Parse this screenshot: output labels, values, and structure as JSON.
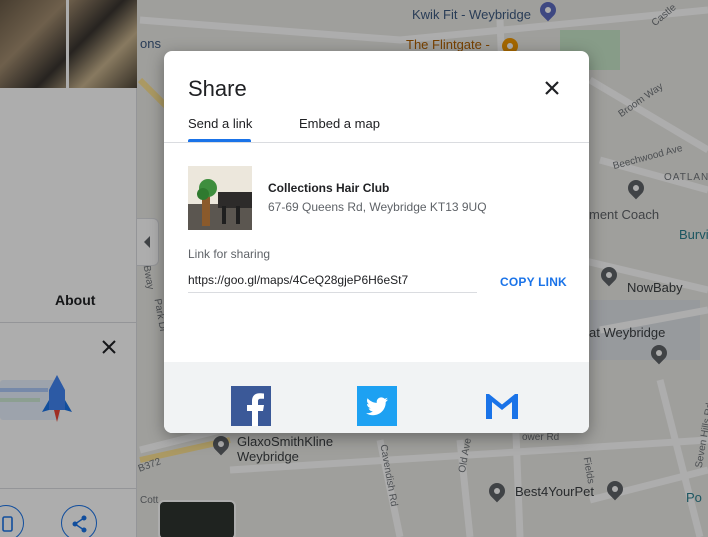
{
  "map": {
    "labels": {
      "kwik_fit": "Kwik Fit - Weybridge",
      "flintgate": "The Flintgate -",
      "ons": "ons",
      "castle": "Castle",
      "broom_way": "Broom Way",
      "beechwood": "Beechwood Ave",
      "oatlands": "OATLANDI",
      "coach": "ment Coach",
      "burvi": "Burvi",
      "nowbaby": "NowBaby",
      "at_weybridge": "at Weybridge",
      "gsk_line1": "GlaxoSmithKline",
      "gsk_line2": "Weybridge",
      "best4yourpet": "Best4YourPet",
      "seven_hills": "Seven Hills Rd",
      "b372": "B372",
      "cavendish": "Cavendish Rd",
      "old_ave": "Old Ave",
      "field": "Fields",
      "po": "Po",
      "bway": "Bway",
      "park_dr": "Park Dr",
      "tower_rd": "ower Rd",
      "cott": "Cott"
    }
  },
  "left_panel": {
    "about_label": "About"
  },
  "dialog": {
    "title": "Share",
    "tabs": [
      "Send a link",
      "Embed a map"
    ],
    "active_tab": 0,
    "place": {
      "name": "Collections Hair Club",
      "address": "67-69 Queens Rd, Weybridge KT13 9UQ"
    },
    "link_label": "Link for sharing",
    "link_value": "https://goo.gl/maps/4CeQ28gjeP6H6eSt7",
    "copy_label": "COPY LINK",
    "social": [
      {
        "name": "facebook-icon",
        "color": "#3b5998"
      },
      {
        "name": "twitter-icon",
        "color": "#1da1f2"
      },
      {
        "name": "gmail-icon",
        "color": "#1a73e8"
      }
    ]
  },
  "colors": {
    "accent": "#1a73e8",
    "facebook": "#3b5998",
    "twitter": "#1da1f2"
  }
}
